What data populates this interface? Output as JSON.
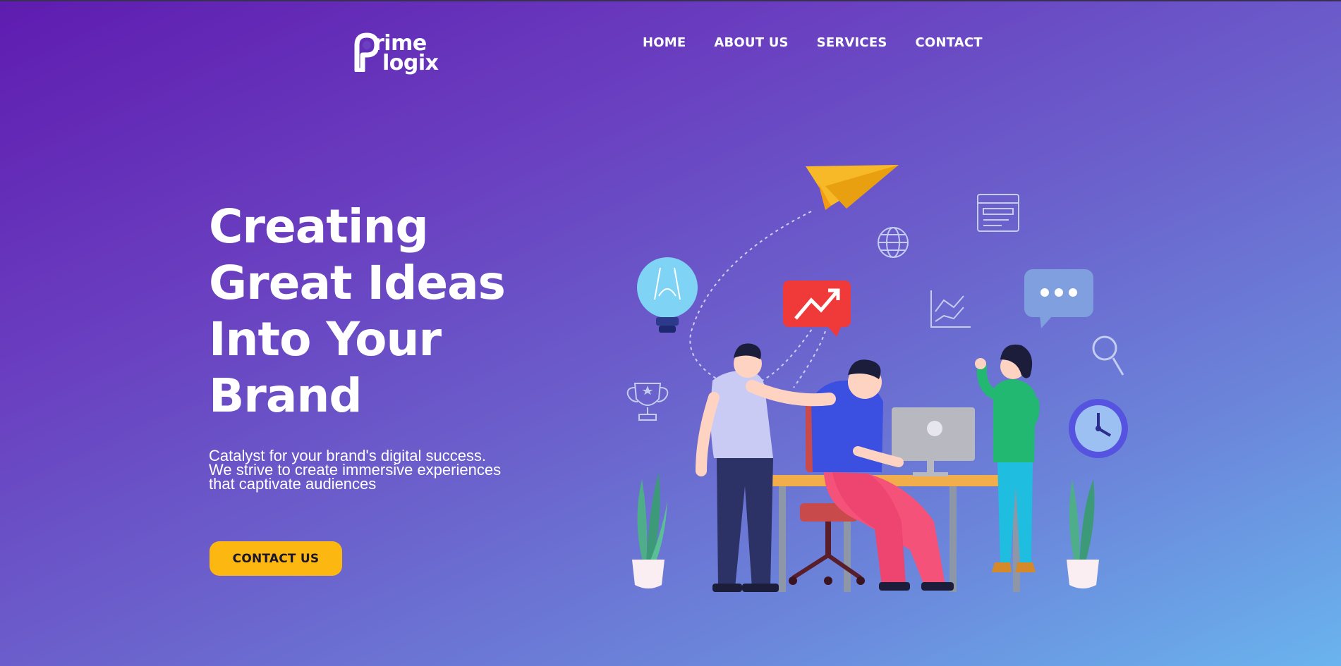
{
  "brand": {
    "logo_line1": "rime",
    "logo_line2": "logix"
  },
  "nav": {
    "items": [
      {
        "label": "HOME"
      },
      {
        "label": "ABOUT US"
      },
      {
        "label": "SERVICES"
      },
      {
        "label": "CONTACT"
      }
    ]
  },
  "hero": {
    "title_lines": [
      "Creating",
      "Great Ideas",
      "Into Your",
      "Brand"
    ],
    "subtitle_lines": [
      "Catalyst for your brand's digital success.",
      "We strive to create immersive experiences",
      "that captivate audiences"
    ],
    "cta_label": "CONTACT US"
  },
  "colors": {
    "gradient_start": "#5f1cb0",
    "gradient_end": "#6ab4ee",
    "accent_yellow": "#fcb711",
    "text": "#ffffff"
  },
  "illustration": {
    "icons": [
      "paper-plane-icon",
      "browser-window-icon",
      "globe-icon",
      "lightbulb-icon",
      "trend-up-chat-icon",
      "line-chart-icon",
      "chat-bubble-icon",
      "magnifier-icon",
      "trophy-icon",
      "clock-icon",
      "plant-icon"
    ]
  }
}
